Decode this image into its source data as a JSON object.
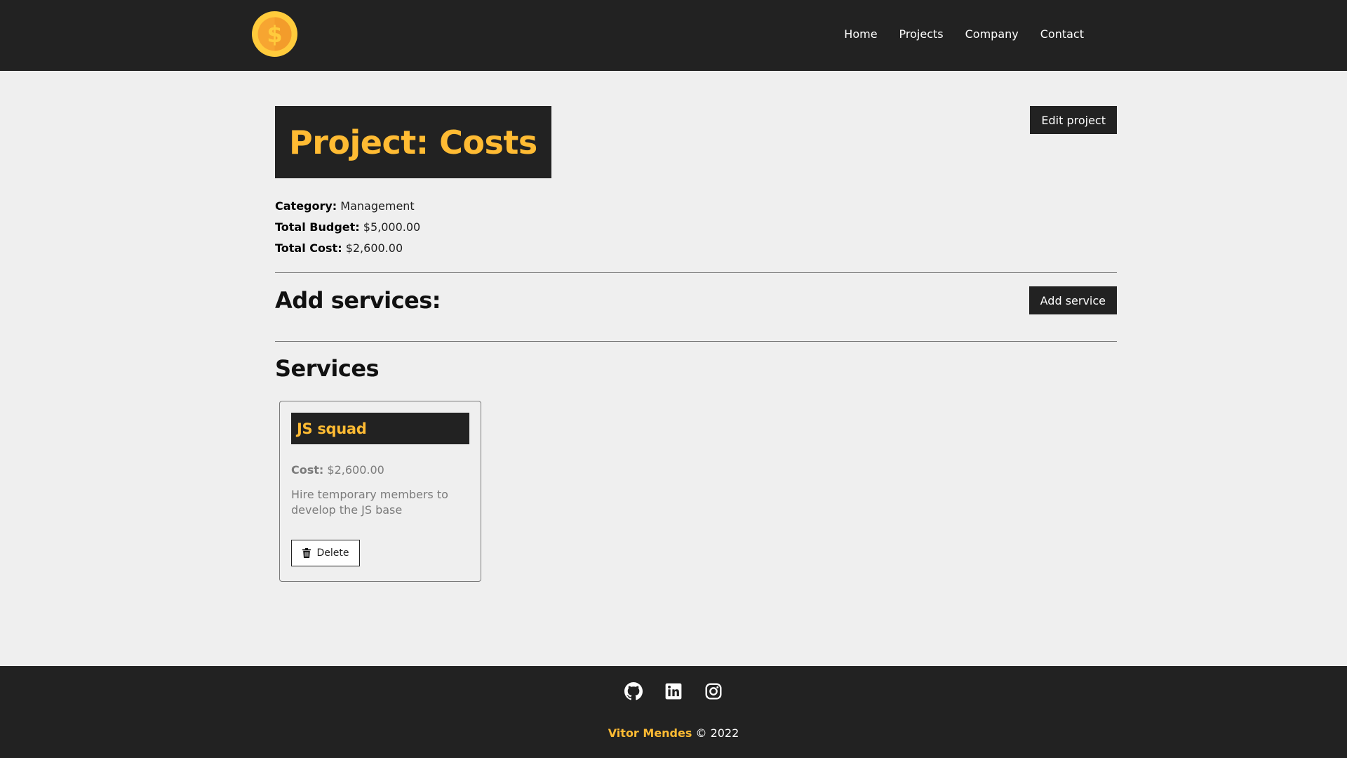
{
  "navbar": {
    "logo_icon": "coin-dollar-icon",
    "links": [
      {
        "label": "Home"
      },
      {
        "label": "Projects"
      },
      {
        "label": "Company"
      },
      {
        "label": "Contact"
      }
    ]
  },
  "project": {
    "title": "Project: Costs",
    "edit_label": "Edit project",
    "info": [
      {
        "key": "Category:",
        "value": "Management"
      },
      {
        "key": "Total Budget:",
        "value": "$5,000.00"
      },
      {
        "key": "Total Cost:",
        "value": "$2,600.00"
      }
    ]
  },
  "add_services": {
    "heading": "Add services:",
    "button_label": "Add service"
  },
  "services": {
    "heading": "Services",
    "items": [
      {
        "name": "JS squad",
        "cost_key": "Cost:",
        "cost_value": "$2,600.00",
        "description": "Hire temporary members to develop the JS base",
        "delete_label": "Delete"
      }
    ]
  },
  "footer": {
    "social_icons": [
      "github-icon",
      "linkedin-icon",
      "instagram-icon"
    ],
    "author": "Vitor Mendes",
    "copyright": "© 2022"
  },
  "colors": {
    "dark": "#222222",
    "accent": "#ffbb33",
    "background": "#efefef"
  }
}
